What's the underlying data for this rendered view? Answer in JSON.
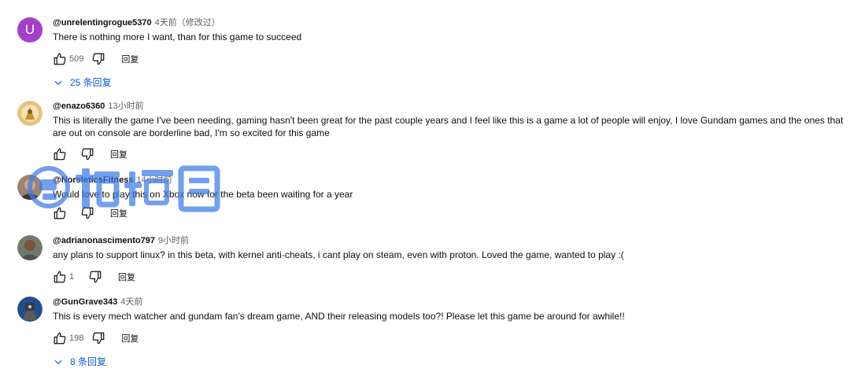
{
  "comments": [
    {
      "author": "@unrelentingrogue5370",
      "time": "4天前（修改过）",
      "avatar_letter": "U",
      "text": "There is nothing more I want, than for this game to succeed",
      "likes": "509",
      "reply_label": "回复",
      "replies_label": "25 条回复"
    },
    {
      "author": "@enazo6360",
      "time": "13小时前",
      "text": "This is literally the game I've been needing, gaming hasn't been great for the past couple years and I feel like this is a game a lot of people will enjoy, I love Gundam games and the ones that are out on console are borderline bad, I'm so excited for this game",
      "likes": "",
      "reply_label": "回复"
    },
    {
      "author": "@NorsleticsFitness",
      "time": "14小时前",
      "text": "Would love to play this on Xbox now for the beta been waiting for a year",
      "likes": "",
      "reply_label": "回复"
    },
    {
      "author": "@adrianonascimento797",
      "time": "9小时前",
      "text": "any plans to support linux? in this beta, with kernel anti-cheats, i cant play on steam, even with proton. Loved the game, wanted to play :(",
      "likes": "1",
      "reply_label": "回复"
    },
    {
      "author": "@GunGrave343",
      "time": "4天前",
      "text": "This is every mech watcher and gundam fan's dream game, AND their releasing models too?! Please let this game be around for awhile!!",
      "likes": "198",
      "reply_label": "回复",
      "replies_label": "8 条回复"
    }
  ],
  "watermark": {
    "text": "领域圈"
  },
  "colors": {
    "link": "#065fd4",
    "avatar_u": "#a43fc8",
    "meta": "#606060"
  }
}
